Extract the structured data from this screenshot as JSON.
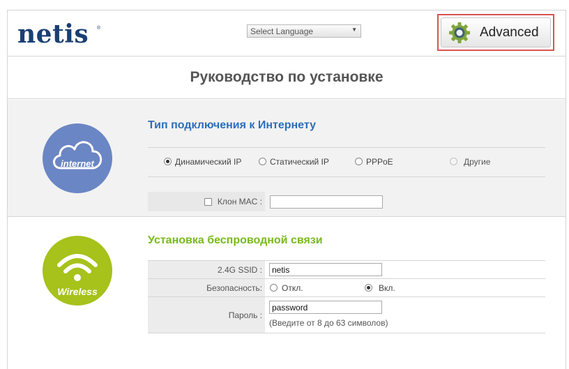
{
  "header": {
    "logo_text": "netis",
    "logo_mark": "®",
    "language_select": {
      "selected": "Select Language",
      "icon": "dropdown-arrow"
    },
    "advanced_button": {
      "label": "Advanced",
      "icon": "gear-icon"
    }
  },
  "page": {
    "title": "Руководство по установке"
  },
  "internet": {
    "badge_label": "internet",
    "badge_icon": "cloud-icon",
    "title": "Тип подключения к Интернету",
    "connection_types": [
      {
        "label": "Динамический IP",
        "checked": true,
        "disabled": false
      },
      {
        "label": "Статический IP",
        "checked": false,
        "disabled": false
      },
      {
        "label": "PPPoE",
        "checked": false,
        "disabled": false
      },
      {
        "label": "Другие",
        "checked": false,
        "disabled": true
      }
    ],
    "mac_clone_label": "Клон MAC :",
    "mac_clone_checked": false,
    "mac_clone_value": ""
  },
  "wireless": {
    "badge_label": "Wireless",
    "badge_icon": "wifi-icon",
    "title": "Установка беспроводной связи",
    "ssid_label": "2.4G SSID :",
    "ssid_value": "netis",
    "security_label": "Безопасность:",
    "security_off_label": "Откл.",
    "security_on_label": "Вкл.",
    "security_selected": "on",
    "password_label": "Пароль :",
    "password_value": "password",
    "password_hint": "(Введите от 8 до 63 символов)"
  },
  "colors": {
    "logo": "#1a3f73",
    "internet_title": "#2a6ebb",
    "wireless_title": "#77bb1a",
    "internet_badge": "#6b86c4",
    "wireless_badge": "#a6c21b",
    "highlight_outline": "#d9534f"
  }
}
